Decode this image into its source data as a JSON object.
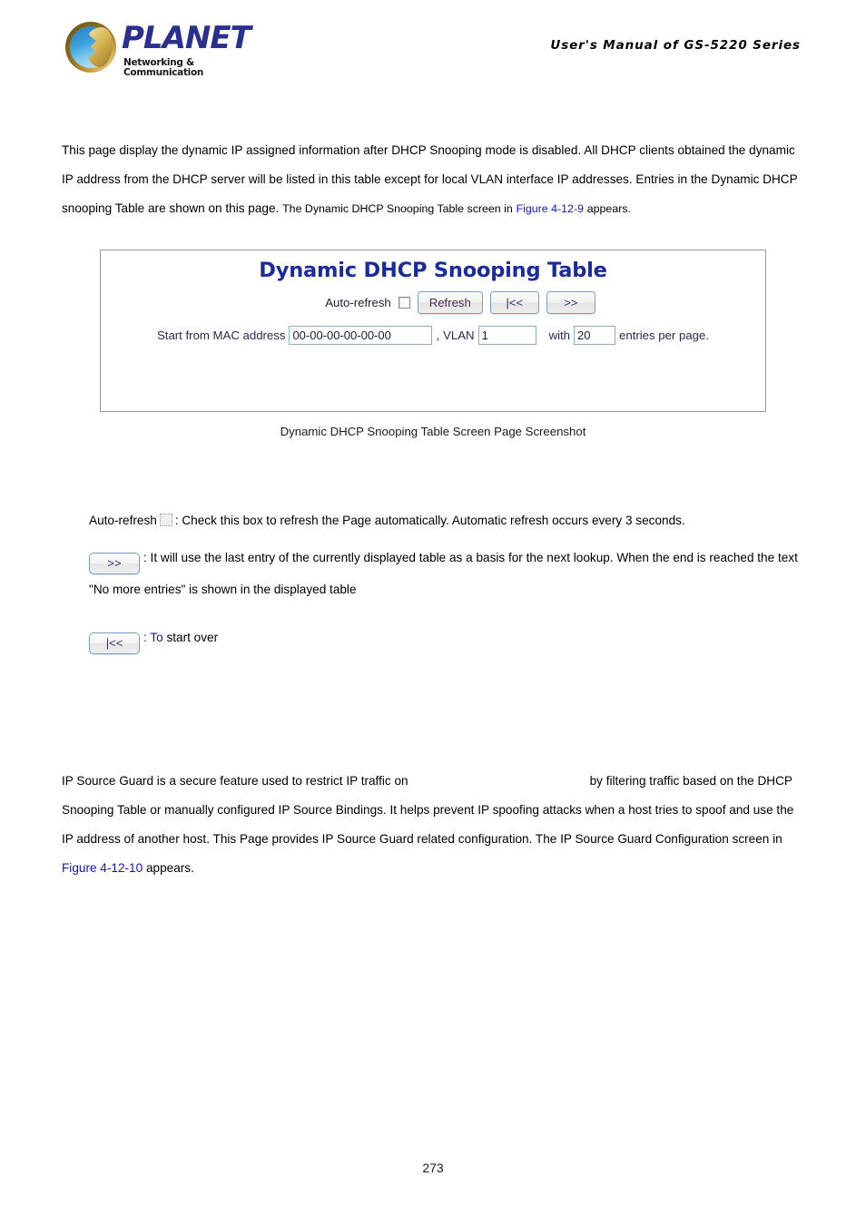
{
  "header": {
    "logo_wordmark": "PLANET",
    "logo_tagline": "Networking & Communication",
    "manual_title": "User's Manual of GS-5220 Series"
  },
  "intro_paragraph": {
    "part1": "This page display the dynamic IP assigned information after DHCP Snooping mode is disabled. All DHCP clients obtained the dynamic IP address from the DHCP server will be listed in this table except for local VLAN interface IP addresses. Entries in the Dynamic DHCP snooping Table are shown on this page.",
    "part2_small": "The Dynamic DHCP Snooping Table screen in",
    "figure_link": "Figure 4-12-9",
    "part3_small": "appears."
  },
  "screenshot_panel": {
    "title": "Dynamic DHCP Snooping Table",
    "auto_refresh_label": "Auto-refresh",
    "auto_refresh_checked": false,
    "refresh_button": "Refresh",
    "first_button": "|<<",
    "next_button": ">>",
    "mac_label": "Start from MAC address",
    "mac_value": "00-00-00-00-00-00",
    "comma": ",",
    "vlan_label": "VLAN",
    "vlan_value": "1",
    "with_label": "with",
    "entries_value": "20",
    "entries_suffix": "entries per page."
  },
  "figure_caption": "Dynamic DHCP Snooping Table Screen Page Screenshot",
  "definitions": {
    "auto_refresh_term": "Auto-refresh",
    "auto_refresh_desc": ": Check this box to refresh the Page automatically. Automatic refresh occurs every 3 seconds.",
    "next_button_label": ">>",
    "next_button_desc": ": It will use the last entry of the currently displayed table as a basis for the next lookup. When the end is reached the text \"No more entries\" is shown in the displayed table",
    "first_button_label": "|<<",
    "first_button_desc_navy": ": To",
    "first_button_desc_rest": "start over"
  },
  "ipsg_paragraph": {
    "part1": "IP Source Guard is a secure feature used to restrict IP traffic on",
    "part2": "by filtering traffic based on the DHCP Snooping Table or manually configured IP Source Bindings. It helps prevent IP spoofing attacks when a host tries to spoof and use the IP address of another host. This Page provides IP Source Guard related configuration. The IP Source Guard Configuration screen in",
    "figure_link": "Figure 4-12-10",
    "part3": "appears."
  },
  "footer": {
    "page_number": "273"
  },
  "colors": {
    "panel_title": "#1b2a9e",
    "link": "#1414c8",
    "logo_blue": "#2b2f8f",
    "navy_text": "#1b1b8c"
  }
}
